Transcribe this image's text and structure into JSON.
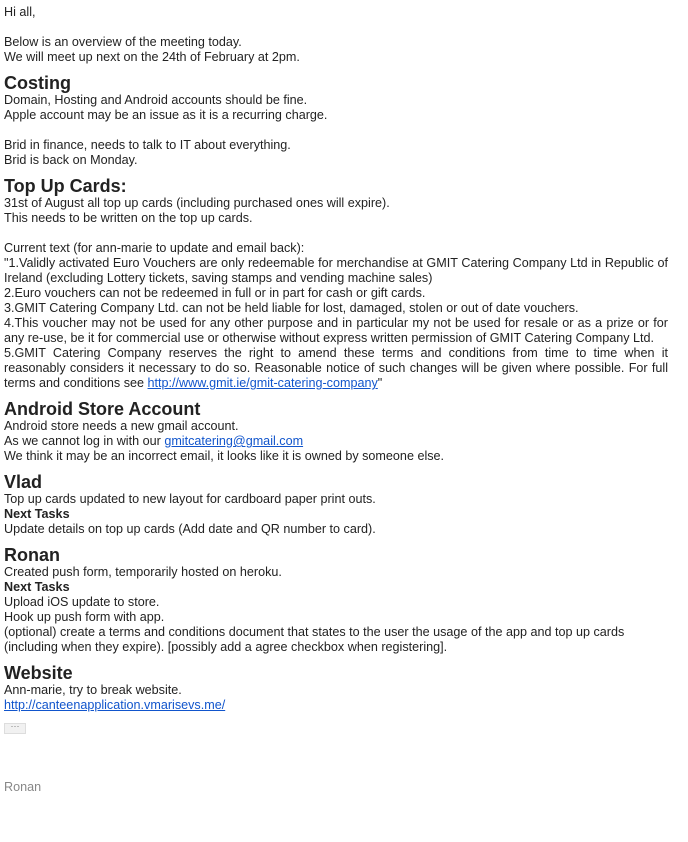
{
  "greeting": "Hi all,",
  "intro": [
    "Below is an overview of the meeting today.",
    "We will meet up next on the 24th of February at 2pm."
  ],
  "costing": {
    "heading": "Costing",
    "lines": [
      "Domain, Hosting and Android accounts should be fine.",
      "Apple account may be an issue as it is a recurring charge."
    ],
    "lines2": [
      "Brid in finance, needs to talk to IT about everything.",
      "Brid is back on Monday."
    ]
  },
  "top_up": {
    "heading": "Top Up Cards:",
    "lines": [
      "31st of August all top up cards (including purchased ones will expire).",
      "This needs to be written on the top up cards."
    ],
    "current_text_label": "Current text (for ann-marie to update and email back):",
    "terms": [
      "\"1.Validly activated Euro Vouchers are only redeemable for merchandise at GMIT Catering Company Ltd in Republic of Ireland (excluding Lottery tickets, saving stamps and vending machine sales)",
      "2.Euro vouchers can not be redeemed in full or in part for cash or gift cards.",
      "3.GMIT Catering Company Ltd. can not be held liable for lost, damaged, stolen or out of date vouchers.",
      "4.This voucher may not be used for any other purpose and in particular my not be used for resale or as a prize or for any re-use, be it for commercial use or otherwise without express written permission of GMIT Catering Company Ltd.",
      "5.GMIT Catering Company reserves the right to amend these terms and conditions from time to time when it reasonably considers it necessary to do so. Reasonable notice of such changes will be given where possible. For full terms and conditions see "
    ],
    "terms_link": "http://www.gmit.ie/gmit-catering-company",
    "terms_close": "\""
  },
  "android": {
    "heading": "Android Store Account",
    "line1": "Android store needs a new gmail account.",
    "line2_prefix": "As we cannot log in with our ",
    "email_link": "gmitcatering@gmail.com",
    "line3": "We think it may be an incorrect email, it looks like it is owned by someone else."
  },
  "vlad": {
    "heading": "Vlad",
    "line1": "Top up cards updated to new layout for cardboard paper print outs.",
    "next_tasks_label": "Next Tasks",
    "task1": "Update details on top up cards (Add date and QR number to card)."
  },
  "ronan": {
    "heading": "Ronan",
    "line1": "Created push form, temporarily hosted on heroku.",
    "next_tasks_label": "Next Tasks",
    "tasks": [
      "Upload iOS update to store.",
      "Hook up push form with app.",
      "(optional) create a terms and conditions document that states to the user the usage of the app and top up cards (including when they expire). [possibly add a agree checkbox when registering]."
    ]
  },
  "website": {
    "heading": "Website",
    "line1": "Ann-marie, try to break website.",
    "link": "http://canteenapplication.vmarisevs.me/"
  },
  "trimmed_content_label": "···",
  "signature": "Ronan"
}
